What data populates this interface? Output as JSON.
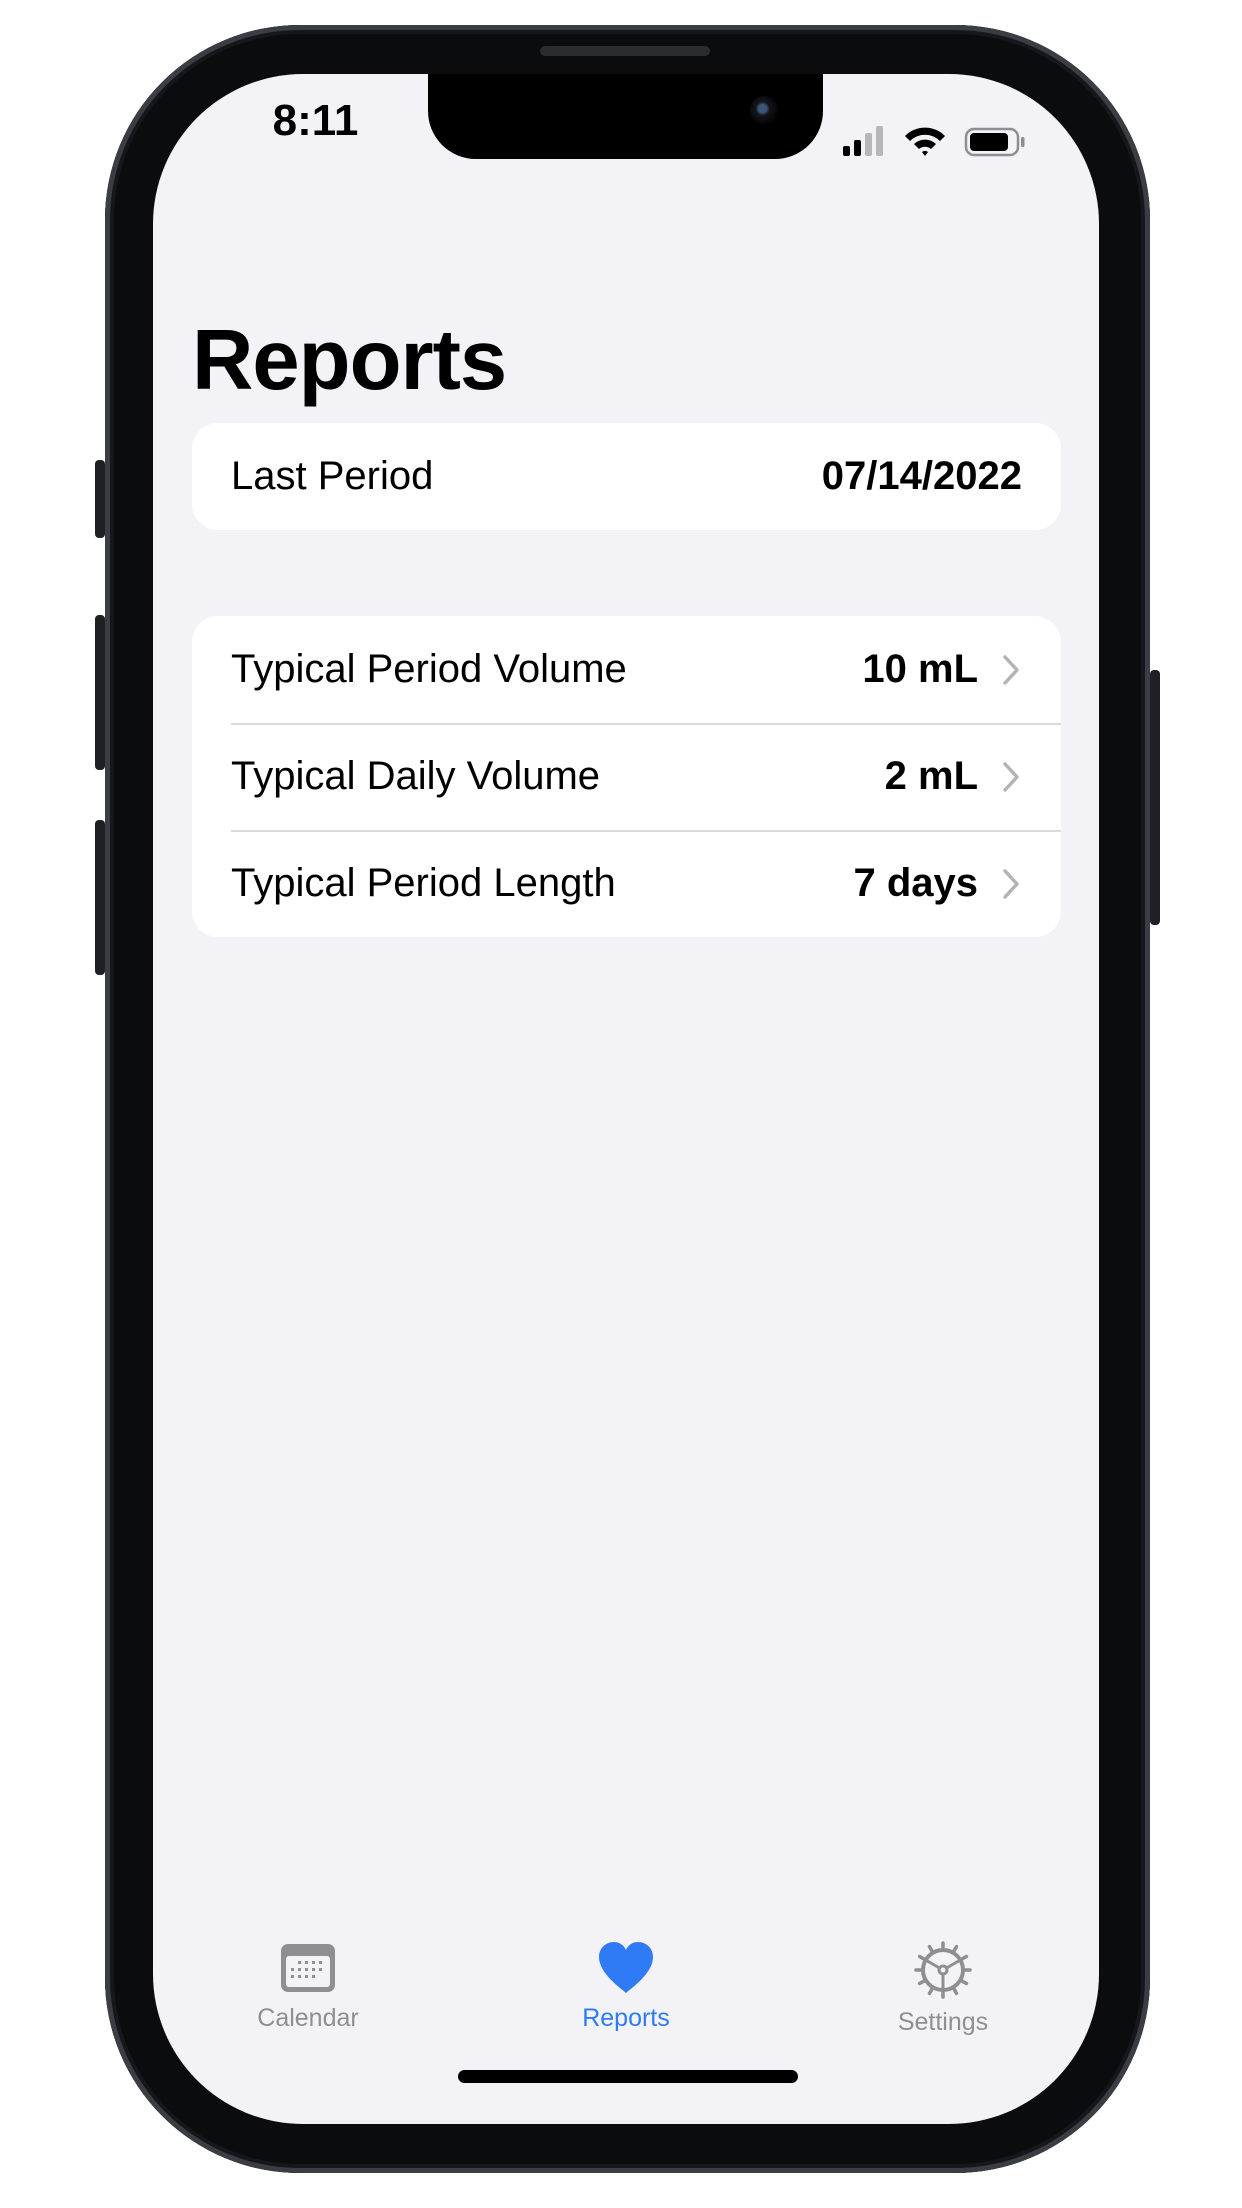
{
  "status_bar": {
    "time": "8:11"
  },
  "page": {
    "title": "Reports"
  },
  "last_period": {
    "label": "Last Period",
    "value": "07/14/2022"
  },
  "stats": [
    {
      "label": "Typical Period Volume",
      "value": "10 mL"
    },
    {
      "label": "Typical Daily Volume",
      "value": "2 mL"
    },
    {
      "label": "Typical Period Length",
      "value": "7 days"
    }
  ],
  "tab_bar": {
    "tabs": [
      {
        "label": "Calendar",
        "icon": "calendar-icon",
        "active": false
      },
      {
        "label": "Reports",
        "icon": "heart-icon",
        "active": true
      },
      {
        "label": "Settings",
        "icon": "gear-icon",
        "active": false
      }
    ]
  },
  "colors": {
    "accent": "#2f7bf5",
    "background": "#f2f2f7",
    "inactive": "#8e8e93"
  }
}
